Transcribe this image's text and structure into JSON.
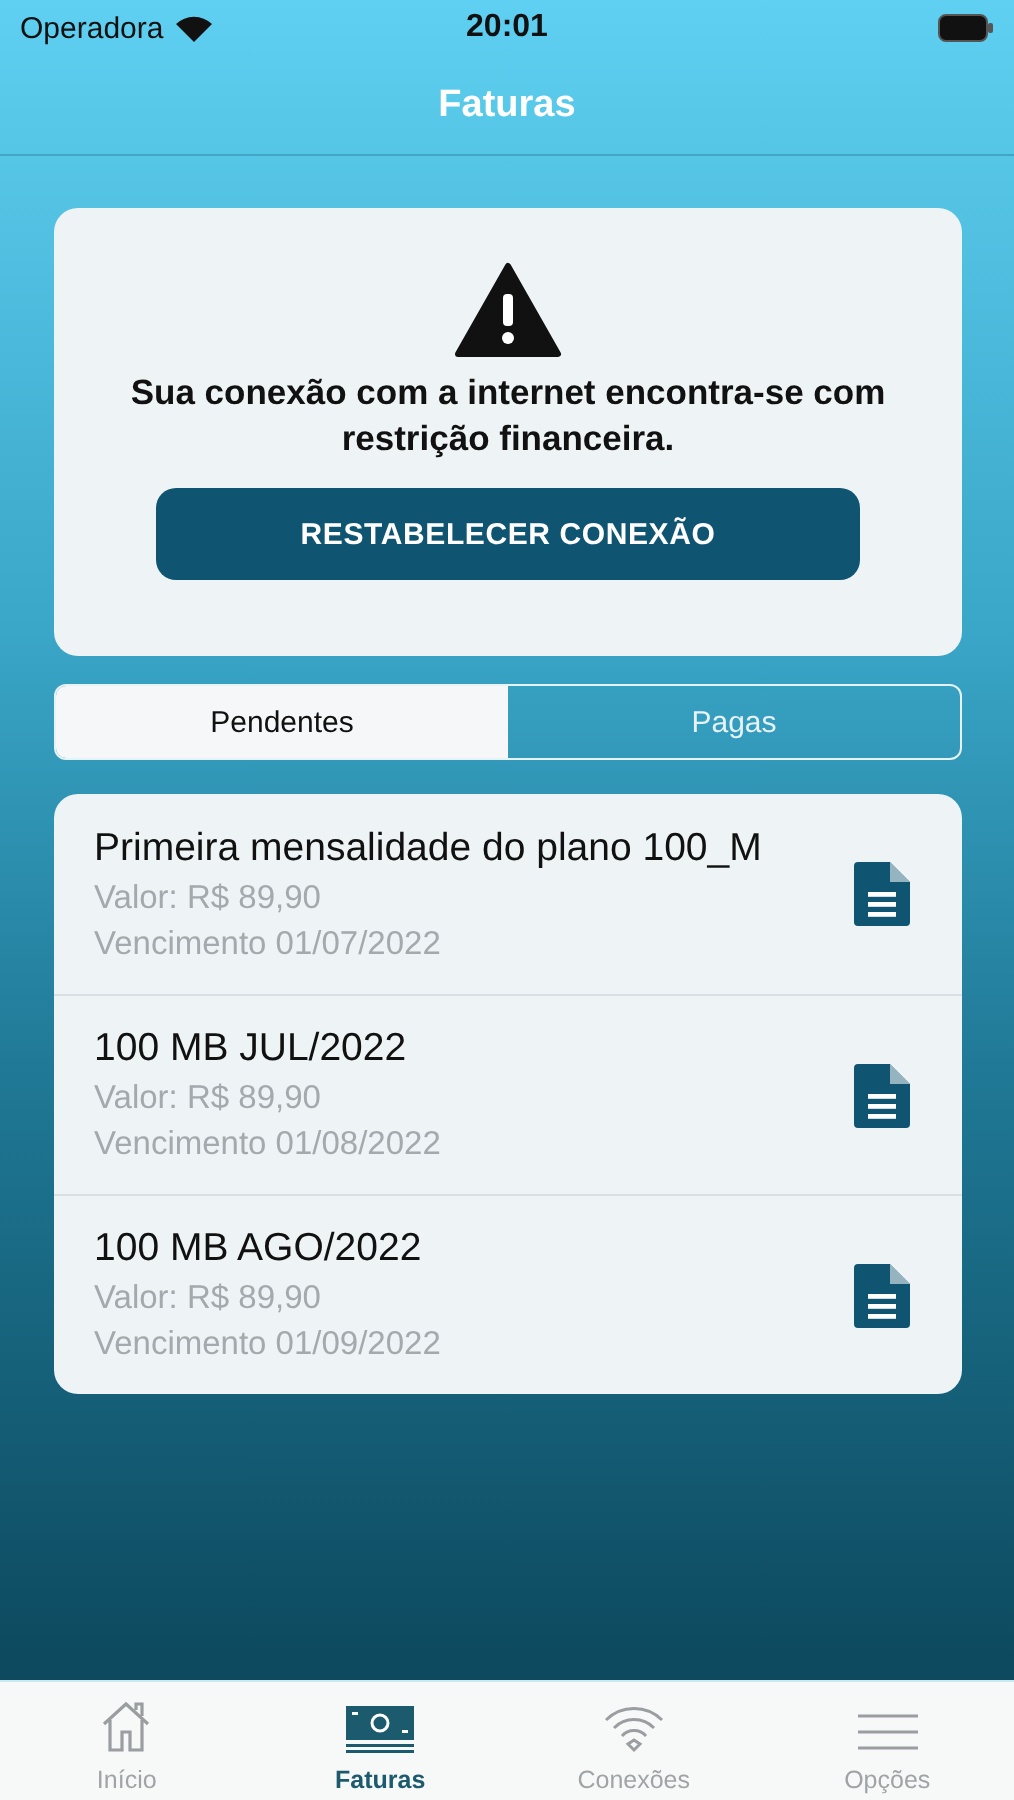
{
  "status_bar": {
    "carrier": "Operadora",
    "time": "20:01"
  },
  "nav": {
    "title": "Faturas"
  },
  "alert": {
    "message": "Sua conexão com a internet encontra-se com restrição financeira.",
    "button": "RESTABELECER CONEXÃO"
  },
  "tabs": [
    {
      "label": "Pendentes",
      "selected": true
    },
    {
      "label": "Pagas",
      "selected": false
    }
  ],
  "invoices": [
    {
      "title": "Primeira mensalidade do plano 100_M",
      "value": "Valor: R$ 89,90",
      "due": "Vencimento 01/07/2022"
    },
    {
      "title": "100 MB JUL/2022",
      "value": "Valor: R$ 89,90",
      "due": "Vencimento 01/08/2022"
    },
    {
      "title": "100 MB AGO/2022",
      "value": "Valor: R$ 89,90",
      "due": "Vencimento 01/09/2022"
    }
  ],
  "tab_bar": [
    {
      "kind": "home",
      "label": "Início",
      "selected": false
    },
    {
      "kind": "money",
      "label": "Faturas",
      "selected": true
    },
    {
      "kind": "wifi",
      "label": "Conexões",
      "selected": false
    },
    {
      "kind": "menu",
      "label": "Opções",
      "selected": false
    }
  ]
}
